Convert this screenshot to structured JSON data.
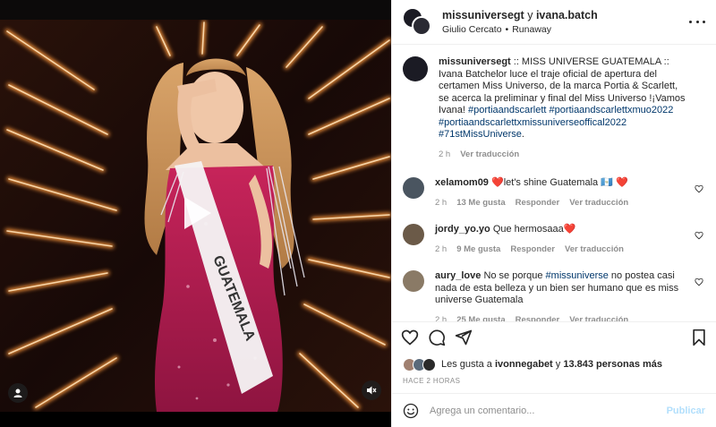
{
  "header": {
    "user1": "missuniversegt",
    "conj": "y",
    "user2": "ivana.batch",
    "sub_left": "Giulio Cercato",
    "sub_sep": "•",
    "sub_right": "Runaway"
  },
  "caption": {
    "username": "missuniversegt",
    "text": ":: MISS UNIVERSE GUATEMALA :: Ivana Batchelor luce el traje oficial de apertura del certamen Miss Universo, de la marca Portia & Scarlett, se acerca la preliminar y final del Miss Universo !¡Vamos Ivana!",
    "tag1": "#portiaandscarlett",
    "tag2": "#portiaandscarlettxmuo2022",
    "tag3": "#portiaandscarlettxmissuniverseoffical2022",
    "tag4": "#71stMissUniverse",
    "tag4_suffix": ".",
    "time": "2 h",
    "translate": "Ver traducción"
  },
  "comments": [
    {
      "username": "xelamom09",
      "text": "❤️let's shine Guatemala 🇬🇹 ❤️",
      "time": "2 h",
      "likes": "13 Me gusta",
      "reply": "Responder",
      "translate": "Ver traducción",
      "avatar_color": "#4a5560"
    },
    {
      "username": "jordy_yo.yo",
      "text": "Que hermosaaa❤️",
      "time": "2 h",
      "likes": "9 Me gusta",
      "reply": "Responder",
      "translate": "Ver traducción",
      "avatar_color": "#6b5a48"
    },
    {
      "username": "aury_love",
      "text_before": "No se porque",
      "mention": "#missuniverse",
      "text_after": "no postea casi nada de esta belleza y un bien ser humano que es miss universe Guatemala",
      "time": "2 h",
      "likes": "25 Me gusta",
      "reply": "Responder",
      "translate": "Ver traducción",
      "avatar_color": "#8a7a66"
    }
  ],
  "likes": {
    "prefix": "Les gusta a",
    "user": "ivonnegabet",
    "middle": "y",
    "count": "13.843 personas más"
  },
  "time_ago": "HACE 2 HORAS",
  "comment_box": {
    "placeholder": "Agrega un comentario...",
    "post_label": "Publicar"
  },
  "colors": {
    "link": "#00376b",
    "muted": "#8e8e8e",
    "post_disabled": "#b2dffc",
    "neon": "#ff9a3c"
  },
  "icons": [
    "heart-icon",
    "comment-icon",
    "share-icon",
    "bookmark-icon",
    "emoji-icon",
    "play-icon",
    "user-tag-icon",
    "mute-icon",
    "more-icon"
  ],
  "media": {
    "sash_text": "GUATEMALA"
  }
}
